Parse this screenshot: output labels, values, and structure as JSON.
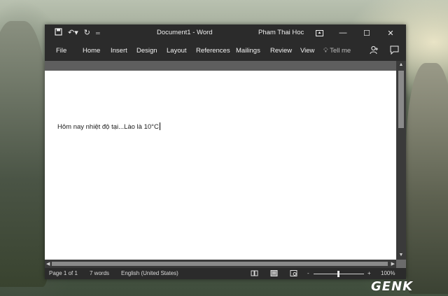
{
  "titlebar": {
    "document_title": "Document1 - Word",
    "user_name": "Pham Thai Hoc",
    "quick_access": {
      "save_icon": "save-icon",
      "undo_icon": "undo-icon",
      "redo_icon": "redo-icon",
      "customize_icon": "customize-qat-icon"
    },
    "window_controls": [
      "ribbon-display-icon",
      "minimize-icon",
      "maximize-icon",
      "close-icon"
    ]
  },
  "ribbon": {
    "tabs": [
      "File",
      "Home",
      "Insert",
      "Design",
      "Layout",
      "References",
      "Mailings",
      "Review",
      "View"
    ],
    "tell_me": "Tell me",
    "share_icon": "share-person-icon",
    "comments_icon": "comment-icon"
  },
  "document": {
    "text": "Hôm nay nhiệt độ tại...Lào là 10°C"
  },
  "statusbar": {
    "page": "Page 1 of 1",
    "words": "7 words",
    "language": "English (United States)",
    "view_icons": [
      "read-mode-icon",
      "print-layout-icon",
      "web-layout-icon"
    ],
    "zoom_minus": "-",
    "zoom_plus": "+",
    "zoom": "100%"
  },
  "watermark": "GENK"
}
